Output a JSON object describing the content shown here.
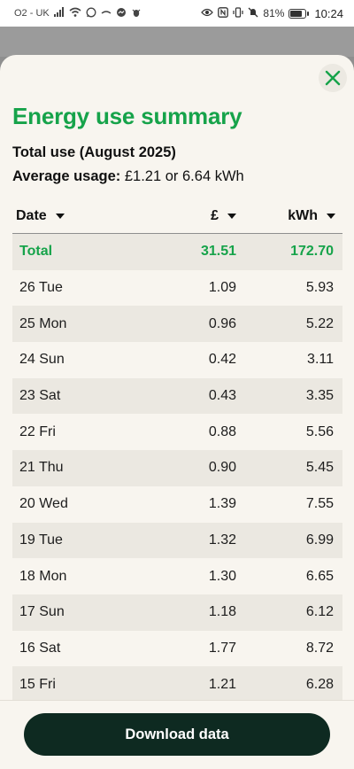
{
  "status_bar": {
    "carrier": "O2 - UK",
    "battery": "81%",
    "battery_level": 0.81,
    "time": "10:24",
    "icons": [
      "signal-icon",
      "wifi-icon",
      "whatsapp-icon",
      "messenger-icon",
      "eye-icon",
      "nfc-icon",
      "vibrate-icon",
      "mute-icon",
      "battery-icon"
    ]
  },
  "modal": {
    "close_icon": "close-icon",
    "title": "Energy use summary",
    "total_use": "Total use (August 2025)",
    "average_label": "Average usage:",
    "average_value": "£1.21 or 6.64 kWh"
  },
  "table": {
    "headers": {
      "date": "Date",
      "gbp": "£",
      "kwh": "kWh"
    },
    "total": {
      "label": "Total",
      "gbp": "31.51",
      "kwh": "172.70"
    },
    "rows": [
      {
        "date": "26 Tue",
        "gbp": "1.09",
        "kwh": "5.93"
      },
      {
        "date": "25 Mon",
        "gbp": "0.96",
        "kwh": "5.22"
      },
      {
        "date": "24 Sun",
        "gbp": "0.42",
        "kwh": "3.11"
      },
      {
        "date": "23 Sat",
        "gbp": "0.43",
        "kwh": "3.35"
      },
      {
        "date": "22 Fri",
        "gbp": "0.88",
        "kwh": "5.56"
      },
      {
        "date": "21 Thu",
        "gbp": "0.90",
        "kwh": "5.45"
      },
      {
        "date": "20 Wed",
        "gbp": "1.39",
        "kwh": "7.55"
      },
      {
        "date": "19 Tue",
        "gbp": "1.32",
        "kwh": "6.99"
      },
      {
        "date": "18 Mon",
        "gbp": "1.30",
        "kwh": "6.65"
      },
      {
        "date": "17 Sun",
        "gbp": "1.18",
        "kwh": "6.12"
      },
      {
        "date": "16 Sat",
        "gbp": "1.77",
        "kwh": "8.72"
      },
      {
        "date": "15 Fri",
        "gbp": "1.21",
        "kwh": "6.28"
      }
    ]
  },
  "footer": {
    "download_label": "Download data"
  },
  "colors": {
    "accent": "#16a34a",
    "button": "#0e2a21",
    "sheet": "#f8f5ef",
    "row_shade": "#ebe8e1"
  }
}
